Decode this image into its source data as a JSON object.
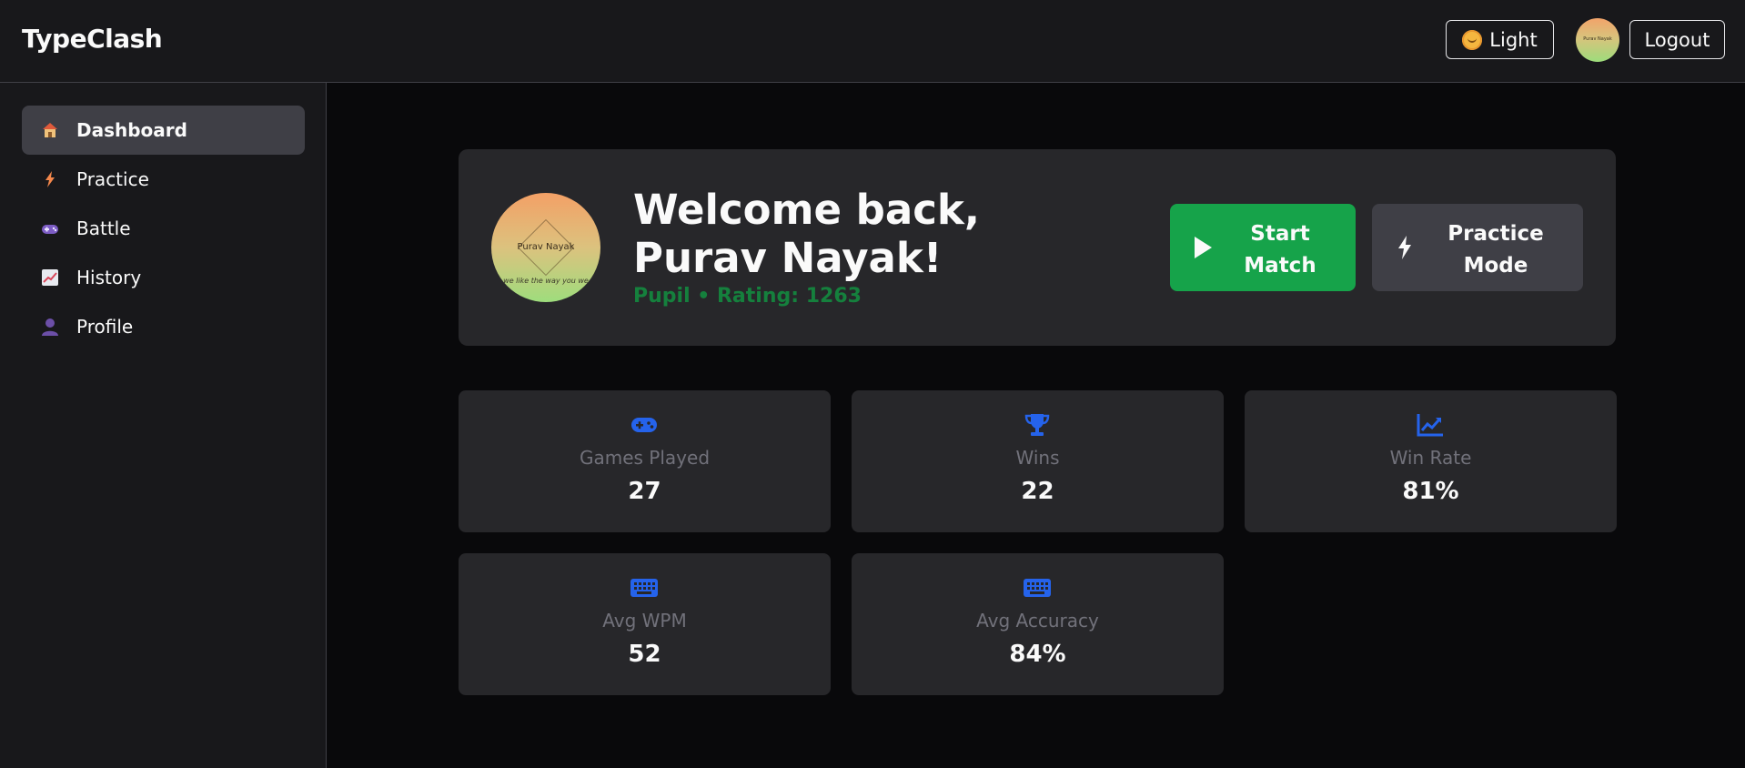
{
  "app": {
    "brand": "TypeClash"
  },
  "header": {
    "theme_label": "Light",
    "theme_icon": "sun-emoji-icon",
    "avatar_name": "Purav Nayak",
    "logout_label": "Logout"
  },
  "sidebar": {
    "items": [
      {
        "label": "Dashboard",
        "icon": "house-icon",
        "active": true
      },
      {
        "label": "Practice",
        "icon": "lightning-icon",
        "active": false
      },
      {
        "label": "Battle",
        "icon": "gamepad-icon",
        "active": false
      },
      {
        "label": "History",
        "icon": "chart-increasing-icon",
        "active": false
      },
      {
        "label": "Profile",
        "icon": "user-silhouette-icon",
        "active": false
      }
    ]
  },
  "hero": {
    "welcome": "Welcome back, Purav Nayak!",
    "subtitle": "Pupil • Rating: 1263",
    "avatar_name": "Purav Nayak",
    "avatar_motto": "we like the way you we",
    "start_label": "Start Match",
    "practice_label": "Practice Mode"
  },
  "stats": [
    {
      "label": "Games Played",
      "value": "27",
      "icon": "gamepad-icon"
    },
    {
      "label": "Wins",
      "value": "22",
      "icon": "trophy-icon"
    },
    {
      "label": "Win Rate",
      "value": "81%",
      "icon": "chart-line-icon"
    },
    {
      "label": "Avg WPM",
      "value": "52",
      "icon": "keyboard-icon"
    },
    {
      "label": "Avg Accuracy",
      "value": "84%",
      "icon": "keyboard-icon"
    }
  ],
  "colors": {
    "accent_green": "#16a34a",
    "rating_green": "#15803d",
    "stat_icon_blue": "#2563eb",
    "card_bg": "#27272a",
    "page_bg": "#09090b"
  }
}
